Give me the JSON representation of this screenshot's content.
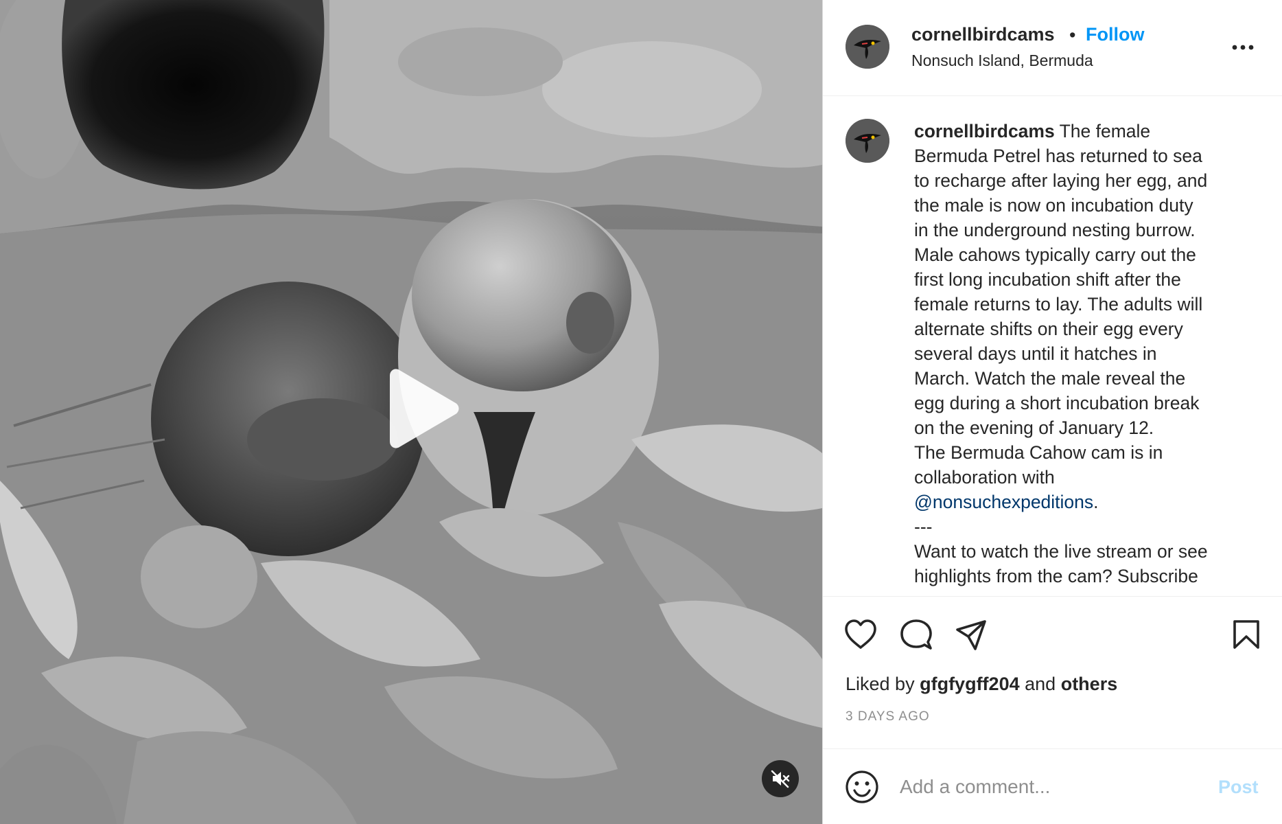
{
  "media": {
    "description_icon": "video-play-icon",
    "mute_icon": "speaker-muted-icon"
  },
  "header": {
    "username": "cornellbirdcams",
    "separator": "•",
    "follow_label": "Follow",
    "location": "Nonsuch Island, Bermuda",
    "more_icon": "more-options-icon"
  },
  "caption": {
    "username": "cornellbirdcams",
    "lines": [
      "The female",
      "Bermuda Petrel has returned to sea",
      "to recharge after laying her egg, and",
      "the male is now on incubation duty",
      "in the underground nesting burrow.",
      "Male cahows typically carry out the",
      "first long incubation shift after the",
      "female returns to lay. The adults will",
      "alternate shifts on their egg every",
      "several days until it hatches in",
      "March. Watch the male reveal the",
      "egg during a short incubation break",
      "on the evening of January 12.",
      "The Bermuda Cahow cam is in",
      "collaboration with"
    ],
    "mention": "@nonsuchexpeditions",
    "mention_suffix": ".",
    "divider": "---",
    "more_lines": [
      "Want to watch the live stream or see",
      "highlights from the cam? Subscribe"
    ]
  },
  "actions": {
    "like_icon": "heart-icon",
    "comment_icon": "comment-icon",
    "share_icon": "share-icon",
    "save_icon": "bookmark-icon",
    "liked_by_prefix": "Liked by",
    "liked_by_user": "gfgfygff204",
    "liked_by_and": "and",
    "liked_by_others": "others",
    "timestamp": "3 DAYS AGO"
  },
  "comment_box": {
    "emoji_icon": "emoji-icon",
    "placeholder": "Add a comment...",
    "post_label": "Post"
  },
  "colors": {
    "accent": "#0095f6",
    "mention": "#00376b",
    "post_disabled": "#b2dffc",
    "muted_text": "#8e8e8e"
  }
}
